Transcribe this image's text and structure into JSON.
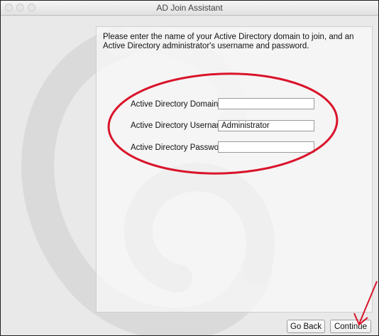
{
  "window": {
    "title": "AD Join Assistant"
  },
  "form": {
    "intro": "Please enter the name of your Active Directory domain to join, and an Active Directory administrator's username and password.",
    "domain_label": "Active Directory Domain:",
    "domain_value": "",
    "username_label": "Active Directory Username:",
    "username_value": "Administrator",
    "password_label": "Active Directory Password:",
    "password_value": ""
  },
  "buttons": {
    "go_back": "Go Back",
    "continue": "Continue"
  },
  "colors": {
    "annotation": "#d9142a",
    "swirl": "#dcdcdc"
  }
}
